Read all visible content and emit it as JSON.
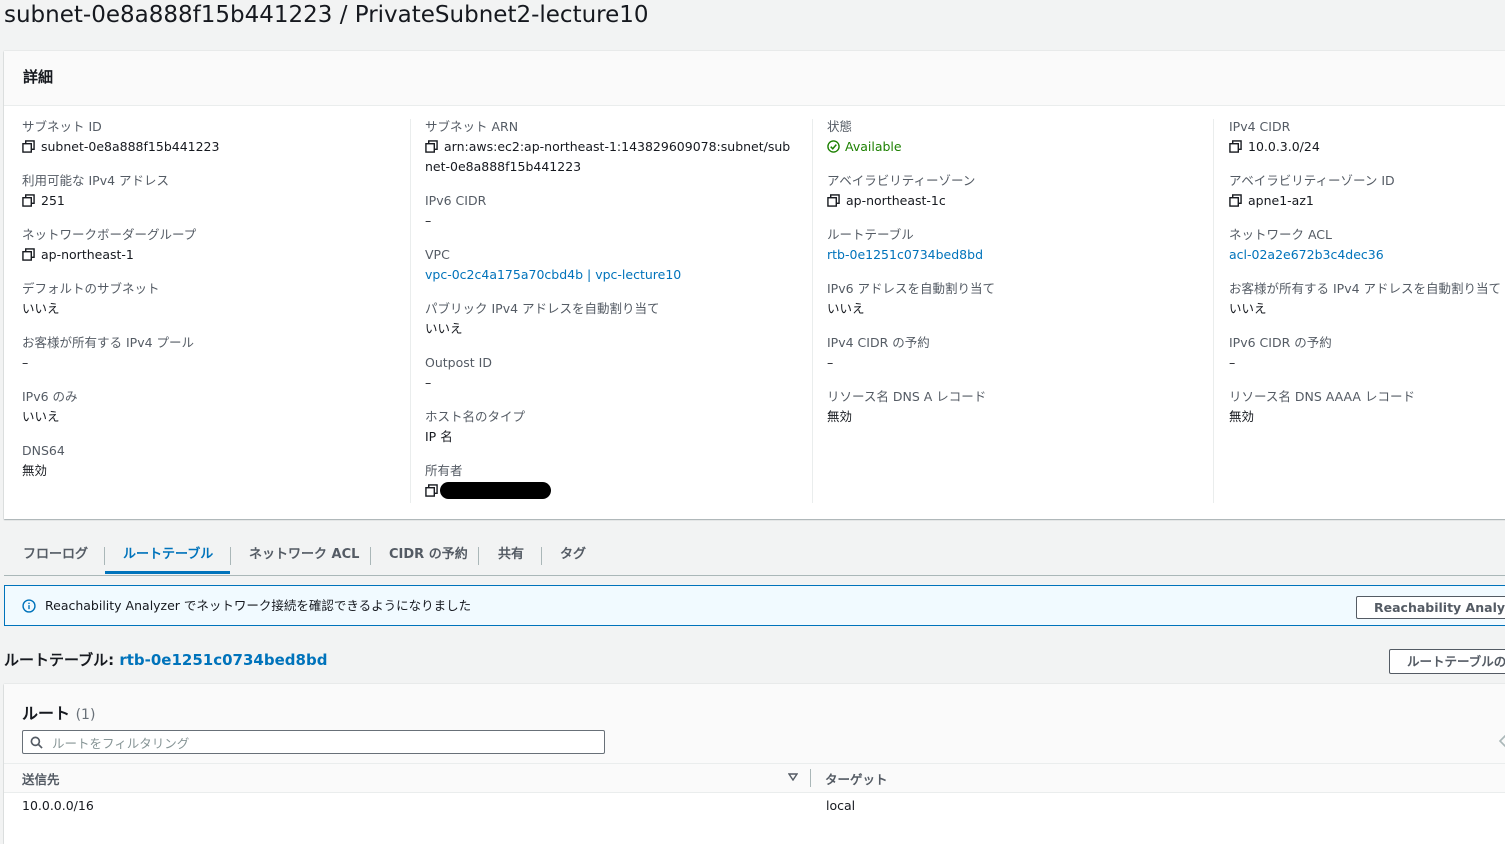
{
  "page": {
    "title": "subnet-0e8a888f15b441223 / PrivateSubnet2-lecture10"
  },
  "details": {
    "header": "詳細",
    "col1": [
      {
        "label": "サブネット ID",
        "value": "subnet-0e8a888f15b441223",
        "copy": true
      },
      {
        "label": "利用可能な IPv4 アドレス",
        "value": "251",
        "copy": true
      },
      {
        "label": "ネットワークボーダーグループ",
        "value": "ap-northeast-1",
        "copy": true
      },
      {
        "label": "デフォルトのサブネット",
        "value": "いいえ"
      },
      {
        "label": "お客様が所有する IPv4 プール",
        "value": "–"
      },
      {
        "label": "IPv6 のみ",
        "value": "いいえ"
      },
      {
        "label": "DNS64",
        "value": "無効"
      }
    ],
    "col2": [
      {
        "label": "サブネット ARN",
        "value": "arn:aws:ec2:ap-northeast-1:143829609078:subnet/subnet-0e8a888f15b441223",
        "copy": true
      },
      {
        "label": "IPv6 CIDR",
        "value": "–"
      },
      {
        "label": "VPC",
        "value": "vpc-0c2c4a175a70cbd4b | vpc-lecture10",
        "link": true
      },
      {
        "label": "パブリック IPv4 アドレスを自動割り当て",
        "value": "いいえ"
      },
      {
        "label": "Outpost ID",
        "value": "–"
      },
      {
        "label": "ホスト名のタイプ",
        "value": "IP 名"
      },
      {
        "label": "所有者",
        "value": "",
        "copy": true,
        "redacted": true
      }
    ],
    "col3": [
      {
        "label": "状態",
        "value": "Available",
        "status": true
      },
      {
        "label": "アベイラビリティーゾーン",
        "value": "ap-northeast-1c",
        "copy": true
      },
      {
        "label": "ルートテーブル",
        "value": "rtb-0e1251c0734bed8bd",
        "link": true
      },
      {
        "label": "IPv6 アドレスを自動割り当て",
        "value": "いいえ"
      },
      {
        "label": "IPv4 CIDR の予約",
        "value": "–"
      },
      {
        "label": "リソース名 DNS A レコード",
        "value": "無効"
      }
    ],
    "col4": [
      {
        "label": "IPv4 CIDR",
        "value": "10.0.3.0/24",
        "copy": true
      },
      {
        "label": "アベイラビリティーゾーン ID",
        "value": "apne1-az1",
        "copy": true
      },
      {
        "label": "ネットワーク ACL",
        "value": "acl-02a2e672b3c4dec36",
        "link": true
      },
      {
        "label": "お客様が所有する IPv4 アドレスを自動割り当て",
        "value": "いいえ"
      },
      {
        "label": "IPv6 CIDR の予約",
        "value": "–"
      },
      {
        "label": "リソース名 DNS AAAA レコード",
        "value": "無効"
      }
    ]
  },
  "tabs": [
    {
      "label": "フローログ",
      "active": false
    },
    {
      "label": "ルートテーブル",
      "active": true
    },
    {
      "label": "ネットワーク ACL",
      "active": false
    },
    {
      "label": "CIDR の予約",
      "active": false
    },
    {
      "label": "共有",
      "active": false
    },
    {
      "label": "タグ",
      "active": false
    }
  ],
  "banner": {
    "text": "Reachability Analyzer でネットワーク接続を確認できるようになりました",
    "button": "Reachability Analyzer"
  },
  "route_table": {
    "heading_label": "ルートテーブル:",
    "heading_link": "rtb-0e1251c0734bed8bd",
    "button": "ルートテーブルの"
  },
  "routes": {
    "title": "ルート",
    "count": "(1)",
    "filter_placeholder": "ルートをフィルタリング",
    "columns": [
      "送信先",
      "ターゲット"
    ],
    "rows": [
      {
        "destination": "10.0.0.0/16",
        "target": "local"
      }
    ]
  },
  "colors": {
    "link": "#0073bb",
    "status_ok": "#1d8102",
    "banner_bg": "#f1faff"
  }
}
